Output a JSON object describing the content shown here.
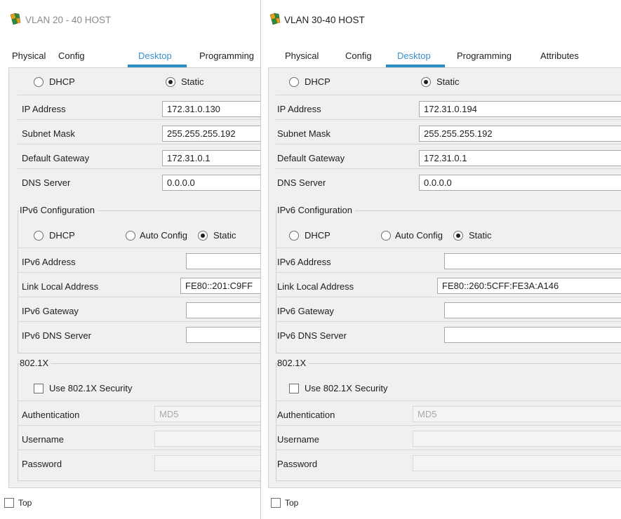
{
  "colors": {
    "accent": "#2b8fc4",
    "active_tab_text": "#3a8fcc",
    "panel_bg": "#f0f0f0",
    "disabled_text": "#a9a9a9"
  },
  "windows": [
    {
      "title": "VLAN 20 - 40 HOST",
      "icon": "packet-tracer-pc-icon",
      "tabs": [
        {
          "label": "Physical",
          "active": false
        },
        {
          "label": "Config",
          "active": false
        },
        {
          "label": "Desktop",
          "active": true
        },
        {
          "label": "Programming",
          "active": false
        }
      ],
      "ipv4": {
        "dhcp_label": "DHCP",
        "static_label": "Static",
        "mode": "Static",
        "ip_label": "IP Address",
        "ip_value": "172.31.0.130",
        "mask_label": "Subnet Mask",
        "mask_value": "255.255.255.192",
        "gateway_label": "Default Gateway",
        "gateway_value": "172.31.0.1",
        "dns_label": "DNS Server",
        "dns_value": "0.0.0.0"
      },
      "ipv6": {
        "group_title": "IPv6 Configuration",
        "dhcp_label": "DHCP",
        "auto_label": "Auto Config",
        "static_label": "Static",
        "mode": "Static",
        "address_label": "IPv6 Address",
        "address_value": "",
        "link_local_label": "Link Local Address",
        "link_local_value": "FE80::201:C9FF",
        "gateway_label": "IPv6 Gateway",
        "gateway_value": "",
        "dns_label": "IPv6 DNS Server",
        "dns_value": ""
      },
      "dot1x": {
        "group_title": "802.1X",
        "use_label": "Use 802.1X Security",
        "use_checked": false,
        "auth_label": "Authentication",
        "auth_value": "MD5",
        "username_label": "Username",
        "username_value": "",
        "password_label": "Password",
        "password_value": ""
      },
      "top_label": "Top",
      "top_checked": false
    },
    {
      "title": "VLAN 30-40 HOST",
      "icon": "packet-tracer-pc-icon",
      "tabs": [
        {
          "label": "Physical",
          "active": false
        },
        {
          "label": "Config",
          "active": false
        },
        {
          "label": "Desktop",
          "active": true
        },
        {
          "label": "Programming",
          "active": false
        },
        {
          "label": "Attributes",
          "active": false
        }
      ],
      "ipv4": {
        "dhcp_label": "DHCP",
        "static_label": "Static",
        "mode": "Static",
        "ip_label": "IP Address",
        "ip_value": "172.31.0.194",
        "mask_label": "Subnet Mask",
        "mask_value": "255.255.255.192",
        "gateway_label": "Default Gateway",
        "gateway_value": "172.31.0.1",
        "dns_label": "DNS Server",
        "dns_value": "0.0.0.0"
      },
      "ipv6": {
        "group_title": "IPv6 Configuration",
        "dhcp_label": "DHCP",
        "auto_label": "Auto Config",
        "static_label": "Static",
        "mode": "Static",
        "address_label": "IPv6 Address",
        "address_value": "",
        "link_local_label": "Link Local Address",
        "link_local_value": "FE80::260:5CFF:FE3A:A146",
        "gateway_label": "IPv6 Gateway",
        "gateway_value": "",
        "dns_label": "IPv6 DNS Server",
        "dns_value": ""
      },
      "dot1x": {
        "group_title": "802.1X",
        "use_label": "Use 802.1X Security",
        "use_checked": false,
        "auth_label": "Authentication",
        "auth_value": "MD5",
        "username_label": "Username",
        "username_value": "",
        "password_label": "Password",
        "password_value": ""
      },
      "top_label": "Top",
      "top_checked": false
    }
  ]
}
